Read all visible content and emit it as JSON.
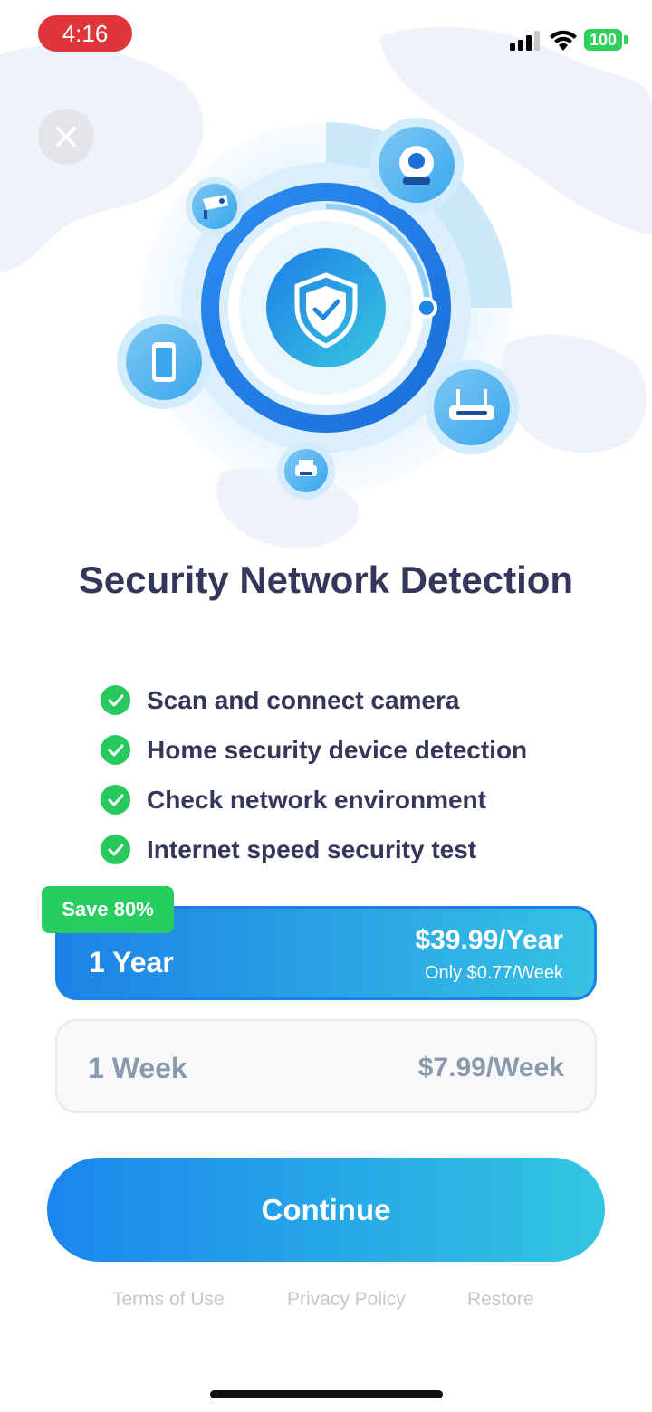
{
  "status_bar": {
    "time": "4:16",
    "battery": "100"
  },
  "title": "Security Network Detection",
  "features": [
    "Scan and connect camera",
    "Home security device detection",
    "Check network environment",
    "Internet speed security test"
  ],
  "plans": {
    "year": {
      "badge": "Save 80%",
      "name": "1 Year",
      "price": "$39.99/Year",
      "sub_price": "Only $0.77/Week",
      "selected": true
    },
    "week": {
      "name": "1 Week",
      "price": "$7.99/Week",
      "selected": false
    }
  },
  "continue_label": "Continue",
  "footer": {
    "terms": "Terms of Use",
    "privacy": "Privacy Policy",
    "restore": "Restore"
  },
  "icons": {
    "close": "close-icon",
    "shield": "shield-check-icon",
    "camera": "webcam-icon",
    "cctv": "cctv-camera-icon",
    "phone": "smartphone-icon",
    "router": "router-icon",
    "printer": "printer-icon",
    "check": "check-icon"
  },
  "colors": {
    "accent_start": "#1c83e6",
    "accent_end": "#36c2e4",
    "success": "#27c95d",
    "title": "#33375a",
    "status_time_bg": "#e0353b"
  }
}
